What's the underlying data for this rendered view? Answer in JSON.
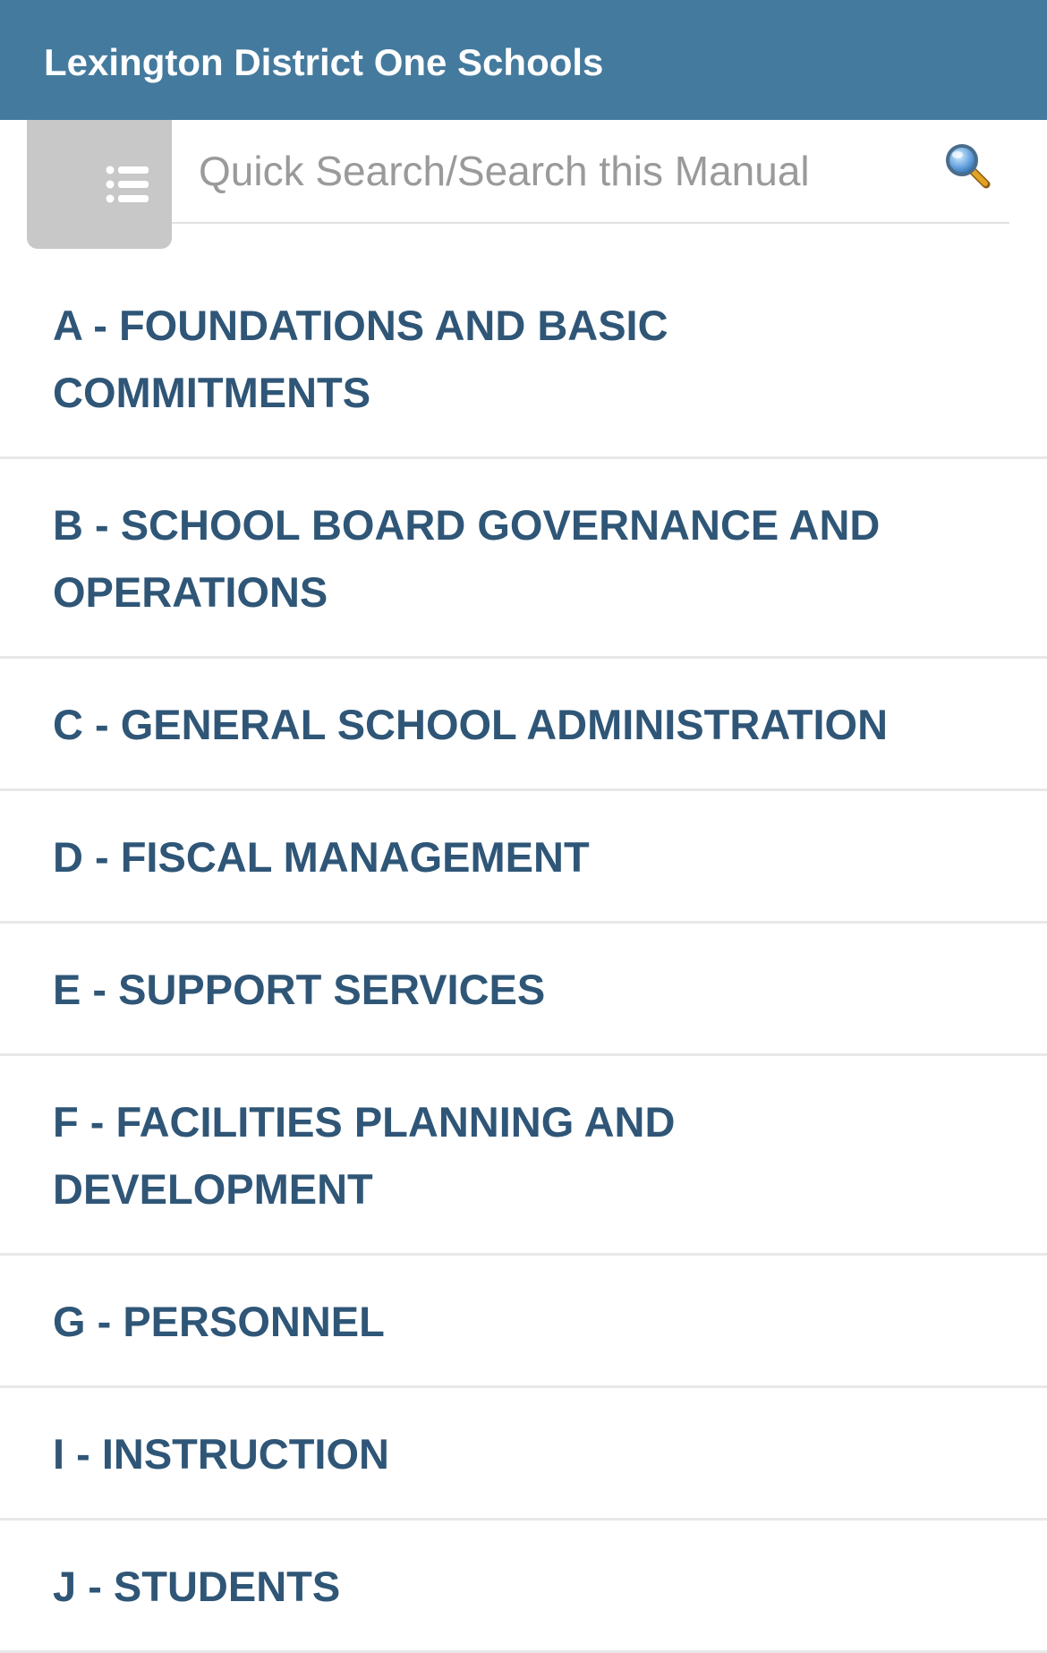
{
  "header": {
    "title": "Lexington District One Schools"
  },
  "toolbar": {
    "menu_icon": "list-icon",
    "search": {
      "placeholder": "Quick Search/Search this Manual",
      "value": "",
      "icon": "magnifier-icon"
    }
  },
  "colors": {
    "header_bg": "#447a9d",
    "header_text": "#ffffff",
    "menu_button_bg": "#c8c8c8",
    "item_text": "#2f5677",
    "divider": "#e8e8e8"
  },
  "sections": [
    {
      "label": "A - FOUNDATIONS AND BASIC COMMITMENTS"
    },
    {
      "label": "B - SCHOOL BOARD GOVERNANCE AND OPERATIONS"
    },
    {
      "label": "C - GENERAL SCHOOL ADMINISTRATION"
    },
    {
      "label": "D - FISCAL MANAGEMENT"
    },
    {
      "label": "E - SUPPORT SERVICES"
    },
    {
      "label": "F - FACILITIES PLANNING AND DEVELOPMENT"
    },
    {
      "label": "G - PERSONNEL"
    },
    {
      "label": "I - INSTRUCTION"
    },
    {
      "label": "J - STUDENTS"
    }
  ]
}
